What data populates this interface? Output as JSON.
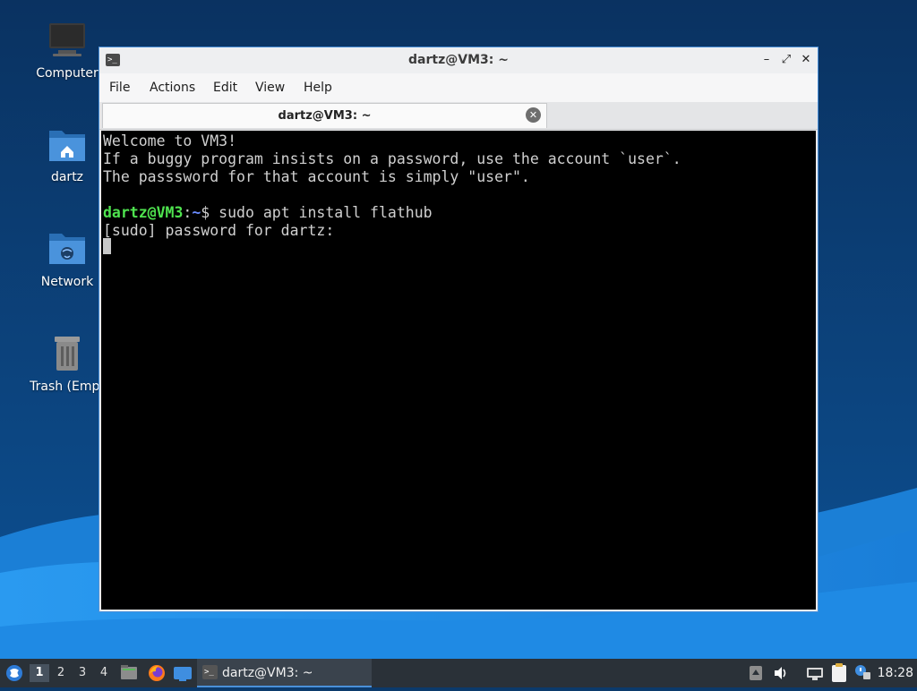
{
  "desktop": {
    "icons": [
      {
        "label": "Computer",
        "icon": "computer-icon"
      },
      {
        "label": "dartz",
        "icon": "home-folder-icon"
      },
      {
        "label": "Network",
        "icon": "network-folder-icon"
      },
      {
        "label": "Trash (Empt",
        "icon": "trash-icon"
      }
    ]
  },
  "window": {
    "title": "dartz@VM3: ~",
    "controls": {
      "minimize": "–",
      "maximize": "⤢",
      "close": "✕"
    },
    "menu": [
      "File",
      "Actions",
      "Edit",
      "View",
      "Help"
    ],
    "tab": {
      "label": "dartz@VM3: ~",
      "close": "✕"
    },
    "terminal": {
      "lines": [
        "Welcome to VM3!",
        "If a buggy program insists on a password, use the account `user`.",
        "The passsword for that account is simply \"user\"."
      ],
      "prompt": {
        "user_host": "dartz@VM3",
        "separator": ":",
        "path": "~",
        "symbol": "$ ",
        "command": "sudo apt install flathub"
      },
      "sudo_prompt": "[sudo] password for dartz:"
    }
  },
  "taskbar": {
    "workspaces": [
      "1",
      "2",
      "3",
      "4"
    ],
    "active_workspace": "1",
    "launchers": [
      "start-menu-icon",
      "file-manager-icon",
      "firefox-icon",
      "show-desktop-icon"
    ],
    "task": {
      "label": "dartz@VM3: ~",
      "icon": "terminal-icon"
    },
    "tray": [
      "updates-icon",
      "volume-icon",
      "network-icon",
      "clipboard-icon",
      "notification-icon"
    ],
    "clock": "18:28"
  },
  "colors": {
    "accent": "#4a90d9",
    "prompt_user": "#4fe34f",
    "prompt_path": "#6b8cff",
    "terminal_bg": "#000000",
    "taskbar_bg": "#2a3138"
  }
}
